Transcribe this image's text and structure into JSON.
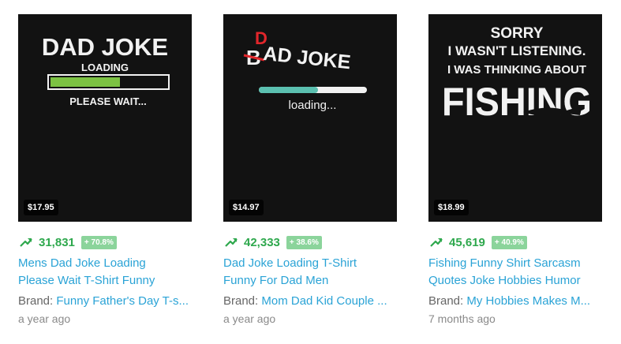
{
  "products": [
    {
      "price": "$17.95",
      "rank": "31,831",
      "delta": "+ 70.8%",
      "title_line1": "Mens Dad Joke Loading",
      "title_line2": "Please Wait T-Shirt Funny",
      "brand_label": "Brand:",
      "brand_name": "Funny Father's Day T-s...",
      "age": "a year ago",
      "design": {
        "line1": "DAD JOKE",
        "line2": "LOADING",
        "line3": "PLEASE WAIT...",
        "loading_fill": 0.6
      }
    },
    {
      "price": "$14.97",
      "rank": "42,333",
      "delta": "+ 38.6%",
      "title_line1": "Dad Joke Loading T-Shirt",
      "title_line2": "Funny For Dad Men",
      "brand_label": "Brand:",
      "brand_name": "Mom Dad Kid Couple ...",
      "age": "a year ago",
      "design": {
        "corrected_letter": "D",
        "crossed_letter": "B",
        "line1_rest": "AD JOKE",
        "line2": "loading...",
        "loading_fill": 0.55
      }
    },
    {
      "price": "$18.99",
      "rank": "45,619",
      "delta": "+ 40.9%",
      "title_line1": "Fishing Funny Shirt Sarcasm",
      "title_line2": "Quotes Joke Hobbies Humor",
      "brand_label": "Brand:",
      "brand_name": "My Hobbies Makes M...",
      "age": "7 months ago",
      "design": {
        "line1": "SORRY",
        "line2": "I WASN'T LISTENING.",
        "line3": "I WAS THINKING ABOUT",
        "line4": "FISHING"
      }
    }
  ],
  "colors": {
    "accent_link": "#2aa3d6",
    "trend_green": "#2ea84d",
    "delta_bg": "#8bd49b",
    "load_green": "#7cc243",
    "load_teal": "#5bc0b0"
  },
  "icons": {
    "trend": "trending-up-arrow-icon"
  }
}
